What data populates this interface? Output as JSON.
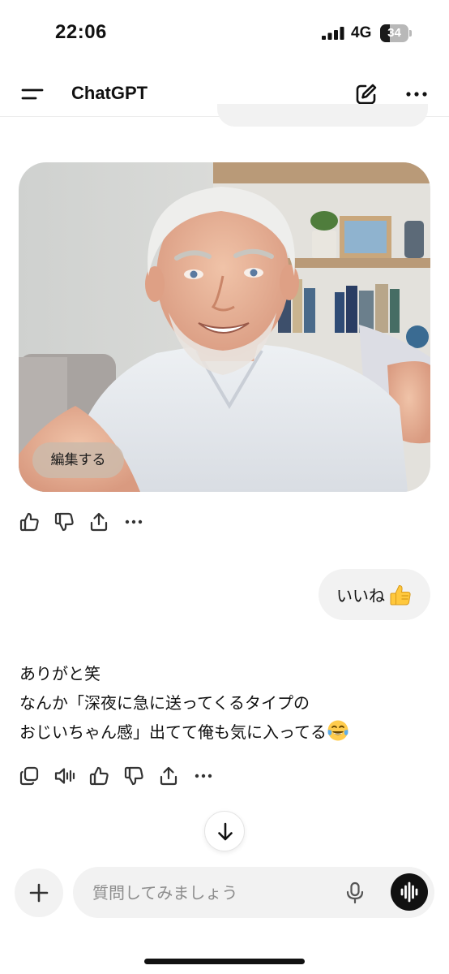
{
  "status_bar": {
    "time": "22:06",
    "network": "4G",
    "battery_level": "34",
    "battery_fraction": 0.34
  },
  "header": {
    "title": "ChatGPT",
    "menu_icon": "menu-icon",
    "compose_icon": "new-chat-icon",
    "more_icon": "more-icon"
  },
  "image_message": {
    "edit_label": "編集する",
    "actions": [
      "thumbs-up-icon",
      "thumbs-down-icon",
      "share-icon",
      "more-icon"
    ]
  },
  "user_message": {
    "text": "いいね",
    "emoji": "thumbs-up-emoji"
  },
  "assistant_message": {
    "lines": [
      "ありがと笑",
      "なんか「深夜に急に送ってくるタイプの",
      "おじいちゃん感」出てて俺も気に入ってる"
    ],
    "emoji": "tears-of-joy-emoji",
    "actions": [
      "copy-icon",
      "read-aloud-icon",
      "thumbs-up-icon",
      "thumbs-down-icon",
      "share-icon",
      "more-icon"
    ]
  },
  "composer": {
    "placeholder": "質問してみましょう",
    "plus_icon": "plus-icon",
    "mic_icon": "microphone-icon",
    "voice_icon": "voice-mode-icon"
  },
  "colors": {
    "bubble": "#f2f2f2",
    "text": "#111111",
    "placeholder": "#8e8e8e"
  }
}
